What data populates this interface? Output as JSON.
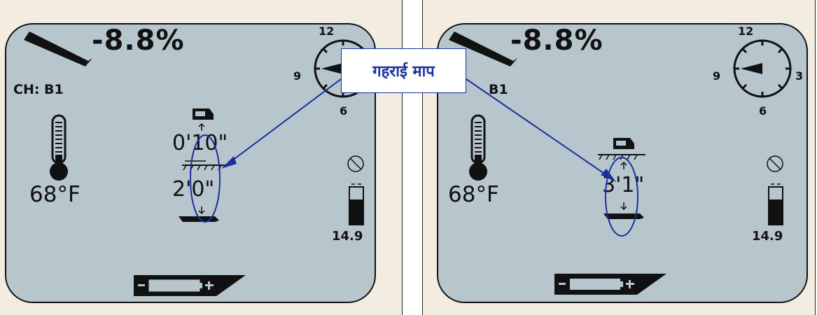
{
  "callout": {
    "label": "गहराई माप"
  },
  "colors": {
    "background": "#f3ece0",
    "lcd": "#b7c6cd",
    "annotation": "#1b2fa0",
    "ink": "#111111"
  },
  "left_screen": {
    "pitch": "-8.8%",
    "channel": "CH: B1",
    "temperature": "68°F",
    "clock_numbers": {
      "top": "12",
      "left": "9",
      "bottom": "6"
    },
    "depth_above": "0'10\"",
    "depth_below": "2'0\"",
    "battery_voltage": "14.9"
  },
  "right_screen": {
    "pitch": "-8.8%",
    "channel": "B1",
    "temperature": "68°F",
    "clock_numbers": {
      "top": "12",
      "left": "9",
      "right": "3",
      "bottom": "6"
    },
    "depth": "3'1\"",
    "battery_voltage": "14.9"
  },
  "icons": {
    "pitch": "probe-pitch-icon",
    "thermometer": "thermometer-icon",
    "clock": "roll-clock-icon",
    "receiver": "receiver-icon",
    "no_signal": "no-interference-icon",
    "battery": "battery-icon",
    "signal_meter": "signal-strength-icon"
  }
}
